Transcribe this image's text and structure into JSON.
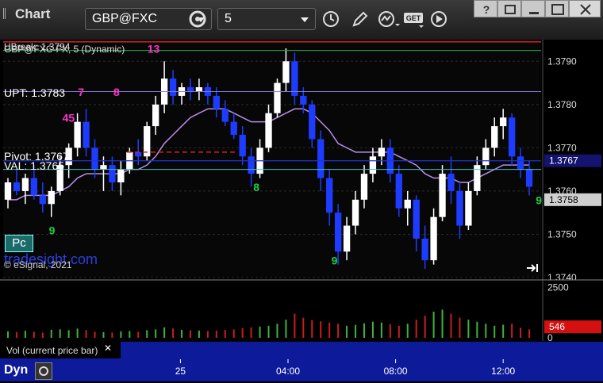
{
  "toolbar": {
    "app_title": "Chart",
    "symbol": "GBP@FXC",
    "interval": "5",
    "icons": [
      "gear-icon",
      "clock-icon",
      "pencil-icon",
      "study-icon",
      "get-icon",
      "play-icon",
      "help-icon",
      "restore-icon",
      "maximize-icon",
      "close-icon"
    ]
  },
  "chart": {
    "legend": "GBP@FXC-FX, 5 (Dynamic)",
    "overlay_legend": "UBreak: 1.3794",
    "levels": [
      {
        "label": "UPT: 1.3783",
        "value": 1.3783
      },
      {
        "label": "Pivot: 1.3767",
        "value": 1.3767
      },
      {
        "label": "VAL: 1.3765",
        "value": 1.3765
      }
    ],
    "last_price": "1.3767",
    "prev_price": "1.3758",
    "pc_label": "Pc",
    "watermark": "tradesight.com",
    "copyright": "© eSignal, 2021",
    "colors": {
      "up": "#ffffff",
      "down": "#1e3cff",
      "ma": "#b88ee8",
      "ubreak": "#d92020",
      "pivot": "#2233cc",
      "val": "#3cc6c6",
      "upt": "#8a7ad8",
      "seq": "#ff33cc",
      "seq_green": "#22cc44"
    }
  },
  "volume": {
    "label": "Vol (current price bar)",
    "last": "546"
  },
  "footer": {
    "label": "Dyn"
  },
  "chart_data": {
    "type": "candlestick",
    "title": "",
    "xlabel": "",
    "ylabel": "",
    "ylim": [
      1.374,
      1.3795
    ],
    "yticks": [
      1.374,
      1.375,
      1.376,
      1.377,
      1.378,
      1.379
    ],
    "xticks": [
      "25",
      "04:00",
      "08:00",
      "12:00"
    ],
    "vol_ticks": [
      0,
      2500
    ],
    "vol_ylim": [
      0,
      2800
    ],
    "seq_labels": [
      {
        "t": "13",
        "x": 0.268,
        "y": 1.3792,
        "c": "seq"
      },
      {
        "t": "8",
        "x": 0.205,
        "y": 1.3782,
        "c": "seq"
      },
      {
        "t": "7",
        "x": 0.139,
        "y": 1.3782,
        "c": "seq"
      },
      {
        "t": "45",
        "x": 0.11,
        "y": 1.3776,
        "c": "seq"
      },
      {
        "t": "8",
        "x": 0.465,
        "y": 1.376,
        "c": "seq_green"
      },
      {
        "t": "9",
        "x": 0.085,
        "y": 1.375,
        "c": "seq_green"
      },
      {
        "t": "9",
        "x": 0.61,
        "y": 1.3743,
        "c": "seq_green"
      },
      {
        "t": "9",
        "x": 0.99,
        "y": 1.3757,
        "c": "seq_green"
      }
    ],
    "price_series": [
      {
        "o": 1.3758,
        "h": 1.3763,
        "l": 1.3756,
        "c": 1.3762
      },
      {
        "o": 1.3762,
        "h": 1.3765,
        "l": 1.3759,
        "c": 1.376
      },
      {
        "o": 1.376,
        "h": 1.3764,
        "l": 1.3757,
        "c": 1.3763
      },
      {
        "o": 1.3763,
        "h": 1.3766,
        "l": 1.3758,
        "c": 1.3759
      },
      {
        "o": 1.3759,
        "h": 1.3762,
        "l": 1.3755,
        "c": 1.3757
      },
      {
        "o": 1.3757,
        "h": 1.3761,
        "l": 1.3754,
        "c": 1.376
      },
      {
        "o": 1.376,
        "h": 1.3768,
        "l": 1.3759,
        "c": 1.3766
      },
      {
        "o": 1.3766,
        "h": 1.3771,
        "l": 1.3763,
        "c": 1.377
      },
      {
        "o": 1.377,
        "h": 1.3778,
        "l": 1.3768,
        "c": 1.3776
      },
      {
        "o": 1.3776,
        "h": 1.3779,
        "l": 1.3768,
        "c": 1.377
      },
      {
        "o": 1.377,
        "h": 1.3772,
        "l": 1.3763,
        "c": 1.3765
      },
      {
        "o": 1.3765,
        "h": 1.3768,
        "l": 1.376,
        "c": 1.3766
      },
      {
        "o": 1.3766,
        "h": 1.3768,
        "l": 1.376,
        "c": 1.3762
      },
      {
        "o": 1.3762,
        "h": 1.3767,
        "l": 1.3759,
        "c": 1.3765
      },
      {
        "o": 1.3765,
        "h": 1.377,
        "l": 1.3764,
        "c": 1.3769
      },
      {
        "o": 1.3769,
        "h": 1.3772,
        "l": 1.3766,
        "c": 1.3768
      },
      {
        "o": 1.3768,
        "h": 1.3776,
        "l": 1.3767,
        "c": 1.3775
      },
      {
        "o": 1.3775,
        "h": 1.3782,
        "l": 1.3773,
        "c": 1.378
      },
      {
        "o": 1.378,
        "h": 1.379,
        "l": 1.3778,
        "c": 1.3786
      },
      {
        "o": 1.3786,
        "h": 1.3788,
        "l": 1.378,
        "c": 1.3782
      },
      {
        "o": 1.3782,
        "h": 1.3785,
        "l": 1.378,
        "c": 1.3784
      },
      {
        "o": 1.3784,
        "h": 1.3786,
        "l": 1.3781,
        "c": 1.3783
      },
      {
        "o": 1.3783,
        "h": 1.3786,
        "l": 1.3781,
        "c": 1.3784
      },
      {
        "o": 1.3784,
        "h": 1.3785,
        "l": 1.378,
        "c": 1.3782
      },
      {
        "o": 1.3782,
        "h": 1.3784,
        "l": 1.3777,
        "c": 1.3779
      },
      {
        "o": 1.3779,
        "h": 1.3781,
        "l": 1.3775,
        "c": 1.3776
      },
      {
        "o": 1.3776,
        "h": 1.3778,
        "l": 1.3772,
        "c": 1.3773
      },
      {
        "o": 1.3773,
        "h": 1.3775,
        "l": 1.3766,
        "c": 1.3768
      },
      {
        "o": 1.3768,
        "h": 1.377,
        "l": 1.3761,
        "c": 1.3764
      },
      {
        "o": 1.3764,
        "h": 1.3772,
        "l": 1.3763,
        "c": 1.377
      },
      {
        "o": 1.377,
        "h": 1.378,
        "l": 1.3769,
        "c": 1.3778
      },
      {
        "o": 1.3778,
        "h": 1.3786,
        "l": 1.3777,
        "c": 1.3785
      },
      {
        "o": 1.3785,
        "h": 1.3793,
        "l": 1.3783,
        "c": 1.379
      },
      {
        "o": 1.379,
        "h": 1.3792,
        "l": 1.378,
        "c": 1.3782
      },
      {
        "o": 1.3782,
        "h": 1.3784,
        "l": 1.3778,
        "c": 1.378
      },
      {
        "o": 1.378,
        "h": 1.3781,
        "l": 1.377,
        "c": 1.3772
      },
      {
        "o": 1.3772,
        "h": 1.3774,
        "l": 1.376,
        "c": 1.3763
      },
      {
        "o": 1.3763,
        "h": 1.3765,
        "l": 1.3752,
        "c": 1.3755
      },
      {
        "o": 1.3755,
        "h": 1.3757,
        "l": 1.3743,
        "c": 1.3746
      },
      {
        "o": 1.3746,
        "h": 1.3754,
        "l": 1.3744,
        "c": 1.3752
      },
      {
        "o": 1.3752,
        "h": 1.376,
        "l": 1.375,
        "c": 1.3758
      },
      {
        "o": 1.3758,
        "h": 1.3766,
        "l": 1.3756,
        "c": 1.3764
      },
      {
        "o": 1.3764,
        "h": 1.377,
        "l": 1.3762,
        "c": 1.3768
      },
      {
        "o": 1.3768,
        "h": 1.3772,
        "l": 1.3766,
        "c": 1.377
      },
      {
        "o": 1.377,
        "h": 1.3772,
        "l": 1.3762,
        "c": 1.3764
      },
      {
        "o": 1.3764,
        "h": 1.3766,
        "l": 1.3754,
        "c": 1.3756
      },
      {
        "o": 1.3756,
        "h": 1.376,
        "l": 1.3752,
        "c": 1.3758
      },
      {
        "o": 1.3758,
        "h": 1.3759,
        "l": 1.3746,
        "c": 1.3749
      },
      {
        "o": 1.3749,
        "h": 1.3752,
        "l": 1.3742,
        "c": 1.3744
      },
      {
        "o": 1.3744,
        "h": 1.3756,
        "l": 1.3743,
        "c": 1.3754
      },
      {
        "o": 1.3754,
        "h": 1.3766,
        "l": 1.3753,
        "c": 1.3764
      },
      {
        "o": 1.3764,
        "h": 1.3768,
        "l": 1.3757,
        "c": 1.376
      },
      {
        "o": 1.376,
        "h": 1.3762,
        "l": 1.3749,
        "c": 1.3752
      },
      {
        "o": 1.3752,
        "h": 1.3762,
        "l": 1.3751,
        "c": 1.376
      },
      {
        "o": 1.376,
        "h": 1.3768,
        "l": 1.3759,
        "c": 1.3766
      },
      {
        "o": 1.3766,
        "h": 1.3772,
        "l": 1.3765,
        "c": 1.377
      },
      {
        "o": 1.377,
        "h": 1.3777,
        "l": 1.3768,
        "c": 1.3775
      },
      {
        "o": 1.3775,
        "h": 1.3779,
        "l": 1.3772,
        "c": 1.3777
      },
      {
        "o": 1.3777,
        "h": 1.3778,
        "l": 1.3766,
        "c": 1.3768
      },
      {
        "o": 1.3768,
        "h": 1.377,
        "l": 1.3763,
        "c": 1.3765
      },
      {
        "o": 1.3765,
        "h": 1.3767,
        "l": 1.3759,
        "c": 1.3761
      }
    ],
    "ma_series": [
      1.3758,
      1.3758,
      1.3759,
      1.3759,
      1.3759,
      1.3759,
      1.376,
      1.3761,
      1.3763,
      1.3764,
      1.3764,
      1.3764,
      1.3764,
      1.3764,
      1.3765,
      1.3765,
      1.3766,
      1.3768,
      1.3771,
      1.3773,
      1.3775,
      1.3777,
      1.3778,
      1.3779,
      1.3779,
      1.3779,
      1.3778,
      1.3777,
      1.3776,
      1.3776,
      1.3776,
      1.3777,
      1.3778,
      1.3779,
      1.3779,
      1.3778,
      1.3776,
      1.3774,
      1.3771,
      1.377,
      1.3769,
      1.3769,
      1.3769,
      1.3769,
      1.3769,
      1.3768,
      1.3767,
      1.3766,
      1.3764,
      1.3763,
      1.3763,
      1.3763,
      1.3762,
      1.3762,
      1.3763,
      1.3764,
      1.3765,
      1.3766,
      1.3766,
      1.3766,
      1.3766
    ],
    "volume_series": [
      320,
      280,
      350,
      300,
      260,
      400,
      420,
      380,
      460,
      390,
      300,
      280,
      260,
      320,
      340,
      300,
      380,
      420,
      520,
      460,
      400,
      380,
      360,
      340,
      360,
      400,
      420,
      480,
      520,
      560,
      600,
      700,
      900,
      1200,
      1000,
      880,
      820,
      760,
      700,
      600,
      640,
      720,
      800,
      760,
      680,
      600,
      700,
      900,
      1100,
      1300,
      1400,
      1200,
      1000,
      900,
      800,
      700,
      600,
      650,
      700,
      500,
      420
    ]
  }
}
